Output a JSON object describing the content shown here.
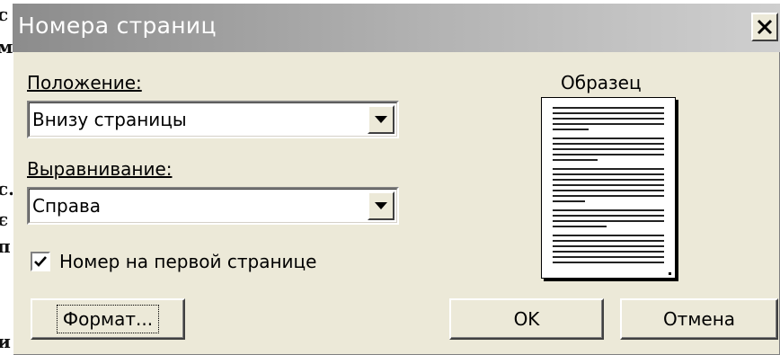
{
  "background_doc": {
    "fragments": [
      "с",
      "м",
      "с.",
      "є",
      "п",
      "и"
    ]
  },
  "dialog": {
    "title": "Номера страниц",
    "close_label": "×"
  },
  "position": {
    "label": "Положение:",
    "value": "Внизу страницы"
  },
  "alignment": {
    "label": "Выравнивание:",
    "value": "Справа"
  },
  "first_page": {
    "label": "Номер на первой странице",
    "checked": true
  },
  "preview": {
    "label": "Образец"
  },
  "buttons": {
    "format": "Формат...",
    "ok": "OK",
    "cancel": "Отмена"
  }
}
